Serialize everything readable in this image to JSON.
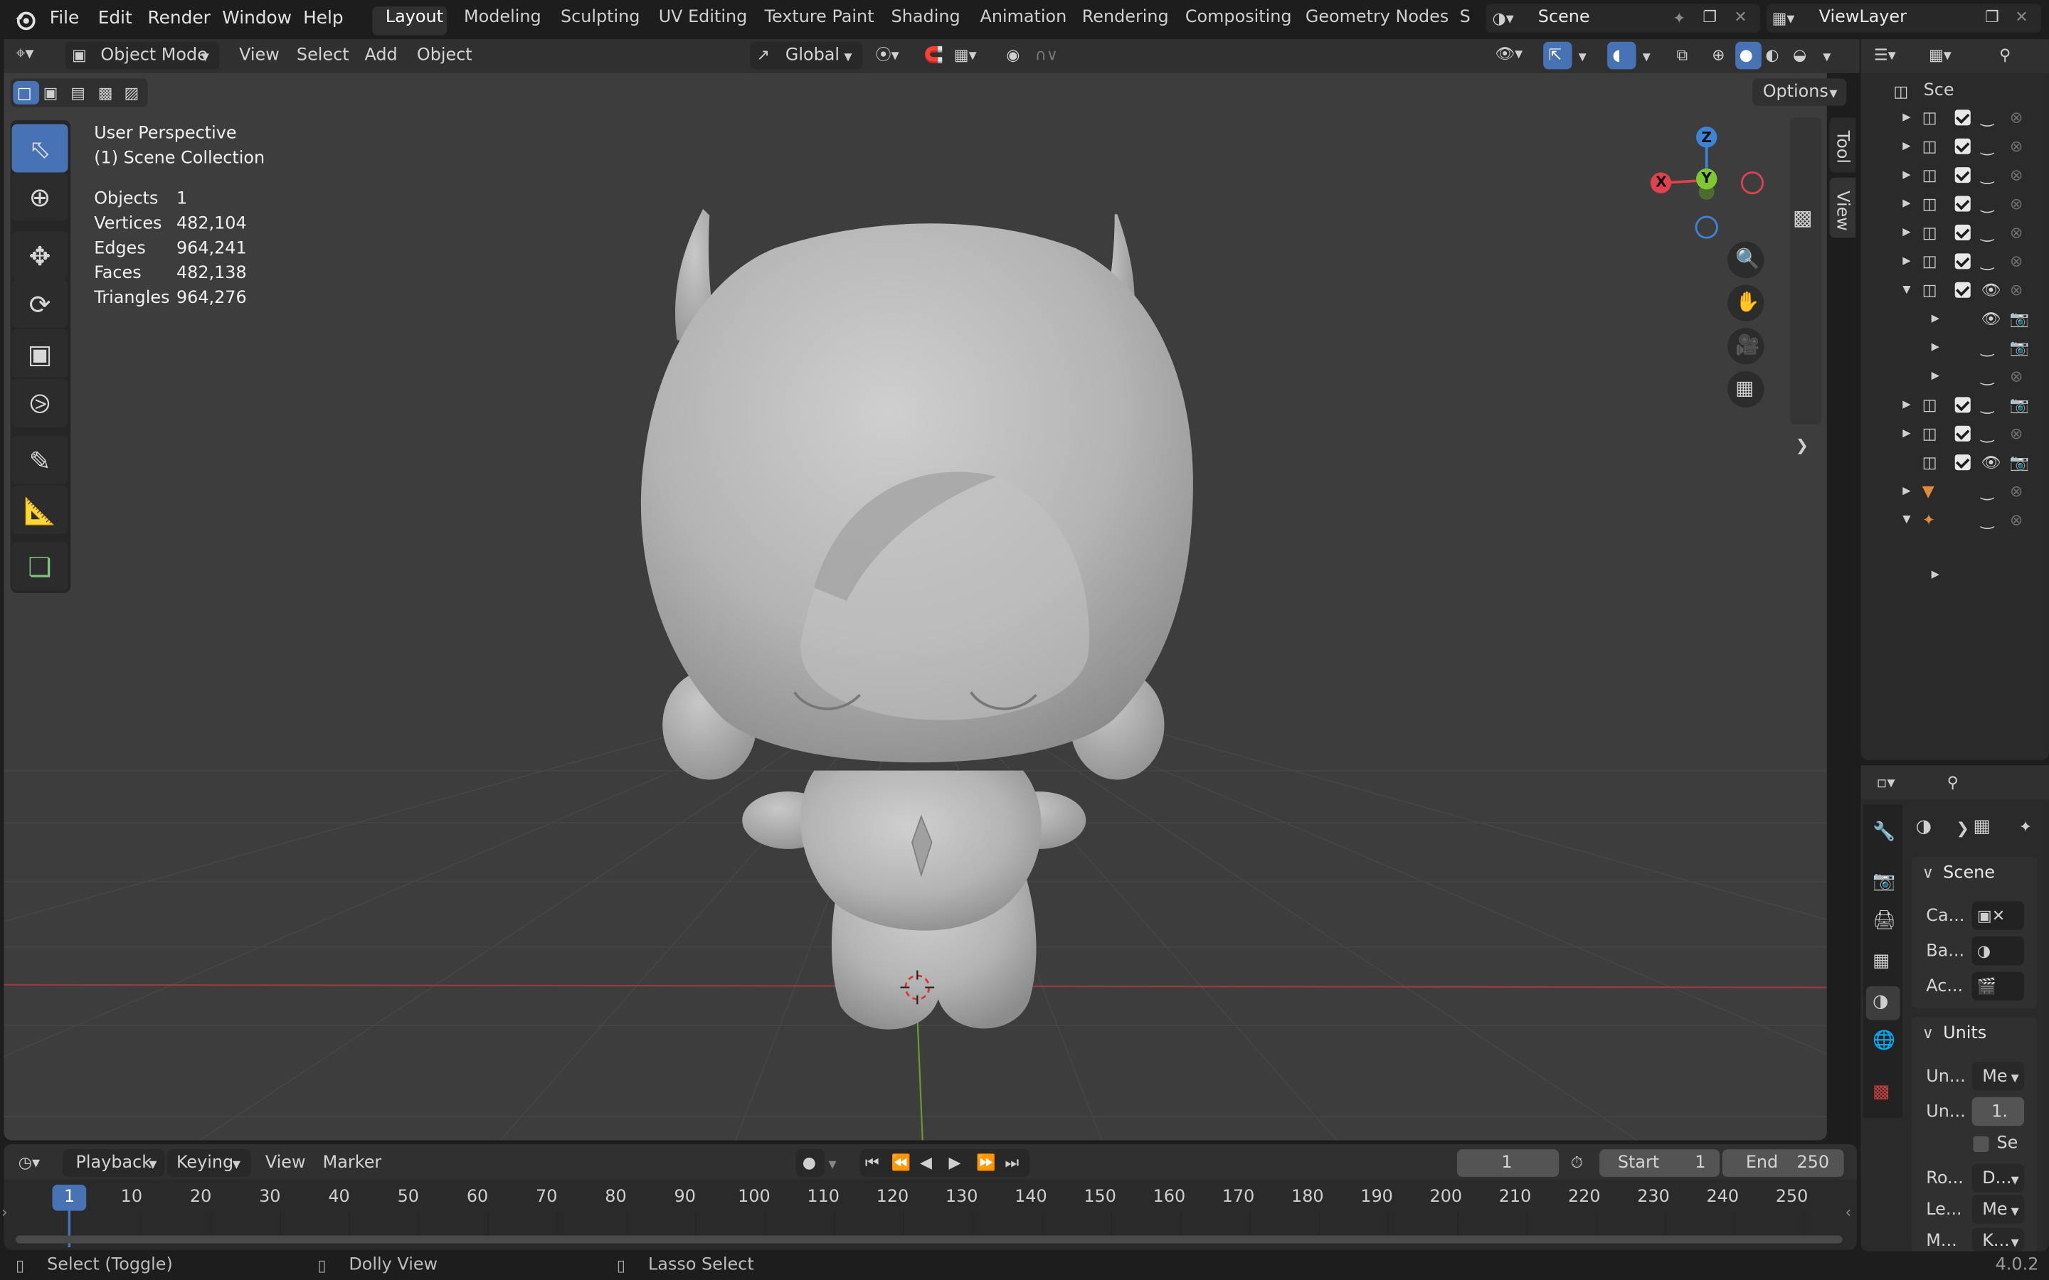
{
  "app": {
    "version": "4.0.2"
  },
  "menu": {
    "file": "File",
    "edit": "Edit",
    "render": "Render",
    "window": "Window",
    "help": "Help"
  },
  "workspaces": [
    "Layout",
    "Modeling",
    "Sculpting",
    "UV Editing",
    "Texture Paint",
    "Shading",
    "Animation",
    "Rendering",
    "Compositing",
    "Geometry Nodes",
    "S"
  ],
  "active_workspace": "Layout",
  "scene": {
    "name": "Scene",
    "view_layer": "ViewLayer"
  },
  "viewport": {
    "mode": "Object Mode",
    "menus": [
      "View",
      "Select",
      "Add",
      "Object"
    ],
    "orientation": "Global",
    "options": "Options",
    "overlay": {
      "title": "User Perspective",
      "collection": "(1) Scene Collection",
      "stats": [
        {
          "label": "Objects",
          "value": "1"
        },
        {
          "label": "Vertices",
          "value": "482,104"
        },
        {
          "label": "Edges",
          "value": "964,241"
        },
        {
          "label": "Faces",
          "value": "482,138"
        },
        {
          "label": "Triangles",
          "value": "964,276"
        }
      ]
    },
    "side_tabs": [
      "Tool",
      "View"
    ],
    "gizmo": {
      "x": "X",
      "y": "Y",
      "z": "Z"
    }
  },
  "outliner": {
    "header": "Sce"
  },
  "properties": {
    "scene_panel": "Scene",
    "scene_rows": [
      {
        "label": "Ca..."
      },
      {
        "label": "Ba..."
      },
      {
        "label": "Ac..."
      }
    ],
    "units_panel": "Units",
    "units_rows": [
      {
        "label": "Un...",
        "value": "Me"
      },
      {
        "label": "Un...",
        "value": "1."
      },
      {
        "label": "",
        "value": "Se"
      },
      {
        "label": "Ro...",
        "value": "D..."
      },
      {
        "label": "Le...",
        "value": "Me"
      },
      {
        "label": "M...",
        "value": "K..."
      }
    ]
  },
  "timeline": {
    "menus": {
      "playback": "Playback",
      "keying": "Keying",
      "view": "View",
      "marker": "Marker"
    },
    "current_frame": "1",
    "start_label": "Start",
    "start": "1",
    "end_label": "End",
    "end": "250",
    "ticks": [
      "1",
      "10",
      "20",
      "30",
      "40",
      "50",
      "60",
      "70",
      "80",
      "90",
      "100",
      "110",
      "120",
      "130",
      "140",
      "150",
      "160",
      "170",
      "180",
      "190",
      "200",
      "210",
      "220",
      "230",
      "240",
      "250"
    ]
  },
  "statusbar": {
    "select": "Select (Toggle)",
    "dolly": "Dolly View",
    "lasso": "Lasso Select"
  },
  "colors": {
    "accent": "#4772b3",
    "x_axis": "#e0414f",
    "y_axis": "#7fc733",
    "z_axis": "#3e84d6",
    "background": "#3d3d3d"
  }
}
